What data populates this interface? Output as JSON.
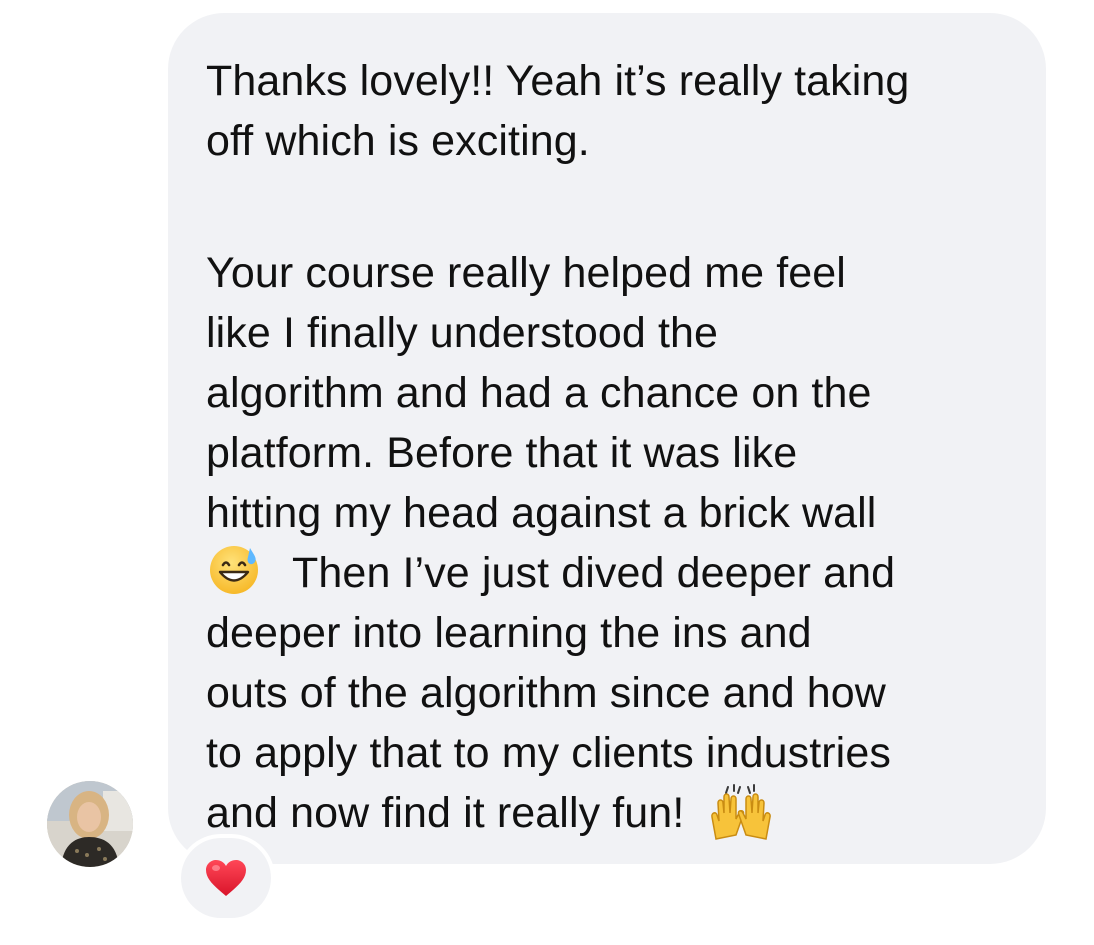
{
  "message": {
    "paragraph1": [
      "Thanks lovely!! Yeah it’s really taking",
      "off which is exciting."
    ],
    "paragraph2": [
      "Your course really helped me feel",
      "like I finally understood the",
      "algorithm and had a chance on the",
      "platform. Before that it was like",
      "hitting my head against a brick wall"
    ],
    "line_after_emoji": "Then I’ve just dived deeper and",
    "paragraph2_rest": [
      "deeper into learning the ins and",
      "outs of the algorithm since and how",
      "to apply that to my clients industries"
    ],
    "last_line": "and now find it really fun!",
    "emoji_1": "grinning-face-with-sweat-icon",
    "emoji_2": "raising-hands-icon"
  },
  "reaction": {
    "icon": "red-heart-icon",
    "color": "#e0202e"
  },
  "colors": {
    "bubble": "#f1f2f5",
    "text": "#111111",
    "background": "#ffffff"
  }
}
